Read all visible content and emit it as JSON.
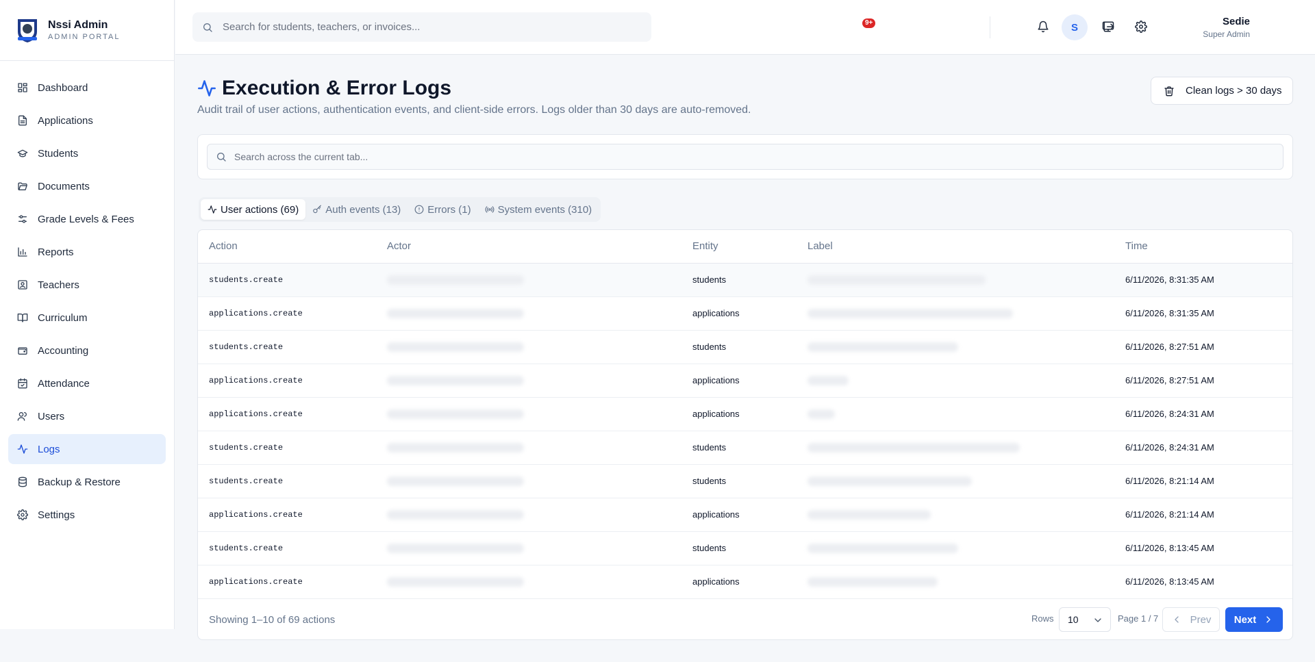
{
  "brand": {
    "title": "Nssi Admin",
    "subtitle": "ADMIN PORTAL"
  },
  "sidebar": {
    "items": [
      {
        "label": "Dashboard",
        "icon": "grid-icon"
      },
      {
        "label": "Applications",
        "icon": "file-text-icon"
      },
      {
        "label": "Students",
        "icon": "graduation-cap-icon"
      },
      {
        "label": "Documents",
        "icon": "folder-open-icon"
      },
      {
        "label": "Grade Levels & Fees",
        "icon": "sliders-icon"
      },
      {
        "label": "Reports",
        "icon": "bar-chart-icon"
      },
      {
        "label": "Teachers",
        "icon": "contact-icon"
      },
      {
        "label": "Curriculum",
        "icon": "book-open-icon"
      },
      {
        "label": "Accounting",
        "icon": "wallet-icon"
      },
      {
        "label": "Attendance",
        "icon": "calendar-check-icon"
      },
      {
        "label": "Users",
        "icon": "users-icon"
      },
      {
        "label": "Logs",
        "icon": "activity-icon",
        "active": true
      },
      {
        "label": "Backup & Restore",
        "icon": "database-icon"
      },
      {
        "label": "Settings",
        "icon": "gear-icon"
      }
    ]
  },
  "topbar": {
    "search_placeholder": "Search for students, teachers, or invoices...",
    "notification_badge": "9+",
    "user_name": "Sedie",
    "user_role": "Super Admin",
    "avatar_initial": "S"
  },
  "page": {
    "title": "Execution & Error Logs",
    "subtitle": "Audit trail of user actions, authentication events, and client-side errors. Logs older than 30 days are auto-removed.",
    "clean_button": "Clean logs > 30 days",
    "search_placeholder": "Search across the current tab..."
  },
  "tabs": [
    {
      "label": "User actions (69)",
      "icon": "activity-icon",
      "active": true
    },
    {
      "label": "Auth events (13)",
      "icon": "key-icon"
    },
    {
      "label": "Errors (1)",
      "icon": "alert-circle-icon"
    },
    {
      "label": "System events (310)",
      "icon": "radio-icon"
    }
  ],
  "table": {
    "columns": [
      "Action",
      "Actor",
      "Entity",
      "Label",
      "Time"
    ],
    "rows": [
      {
        "action": "students.create",
        "entity": "students",
        "time": "6/11/2026, 8:31:35 AM"
      },
      {
        "action": "applications.create",
        "entity": "applications",
        "time": "6/11/2026, 8:31:35 AM"
      },
      {
        "action": "students.create",
        "entity": "students",
        "time": "6/11/2026, 8:27:51 AM"
      },
      {
        "action": "applications.create",
        "entity": "applications",
        "time": "6/11/2026, 8:27:51 AM"
      },
      {
        "action": "applications.create",
        "entity": "applications",
        "time": "6/11/2026, 8:24:31 AM"
      },
      {
        "action": "students.create",
        "entity": "students",
        "time": "6/11/2026, 8:24:31 AM"
      },
      {
        "action": "students.create",
        "entity": "students",
        "time": "6/11/2026, 8:21:14 AM"
      },
      {
        "action": "applications.create",
        "entity": "applications",
        "time": "6/11/2026, 8:21:14 AM"
      },
      {
        "action": "students.create",
        "entity": "students",
        "time": "6/11/2026, 8:13:45 AM"
      },
      {
        "action": "applications.create",
        "entity": "applications",
        "time": "6/11/2026, 8:13:45 AM"
      }
    ]
  },
  "footer": {
    "showing": "Showing 1–10 of 69 actions",
    "rows_label": "Rows",
    "rows_value": "10",
    "page_info": "Page 1 / 7",
    "prev_label": "Prev",
    "next_label": "Next"
  }
}
